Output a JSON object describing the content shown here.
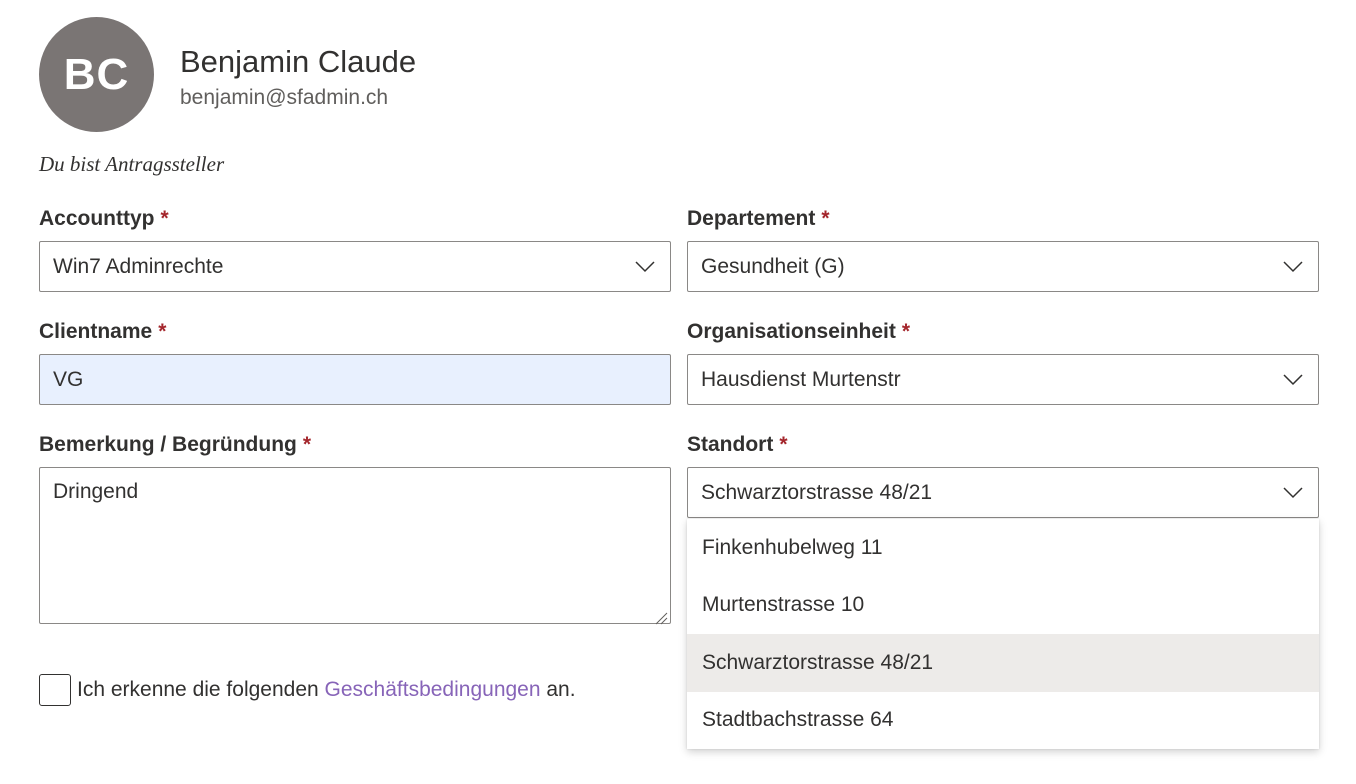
{
  "user": {
    "initials": "BC",
    "name": "Benjamin Claude",
    "email": "benjamin@sfadmin.ch",
    "avatar_color": "#7a7574"
  },
  "role_note": "Du bist Antragssteller",
  "required_marker": "*",
  "form": {
    "accounttyp": {
      "label": "Accounttyp",
      "value": "Win7 Adminrechte"
    },
    "departement": {
      "label": "Departement",
      "value": "Gesundheit (G)"
    },
    "clientname": {
      "label": "Clientname",
      "value": "VG"
    },
    "organisationseinheit": {
      "label": "Organisationseinheit",
      "value": "Hausdienst Murtenstr"
    },
    "bemerkung": {
      "label": "Bemerkung / Begründung",
      "value": "Dringend"
    },
    "standort": {
      "label": "Standort",
      "value": "Schwarztorstrasse 48/21",
      "options": [
        "Finkenhubelweg 11",
        "Murtenstrasse 10",
        "Schwarztorstrasse 48/21",
        "Stadtbachstrasse 64"
      ],
      "selected_index": 2
    }
  },
  "terms": {
    "prefix": "Ich erkenne die folgenden",
    "link": "Geschäftsbedingungen",
    "suffix": "an.",
    "checked": false
  },
  "colors": {
    "required": "#a4262c",
    "link": "#8764b8",
    "autofill_bg": "#e8f0fe",
    "selected_option_bg": "#edebe9"
  }
}
